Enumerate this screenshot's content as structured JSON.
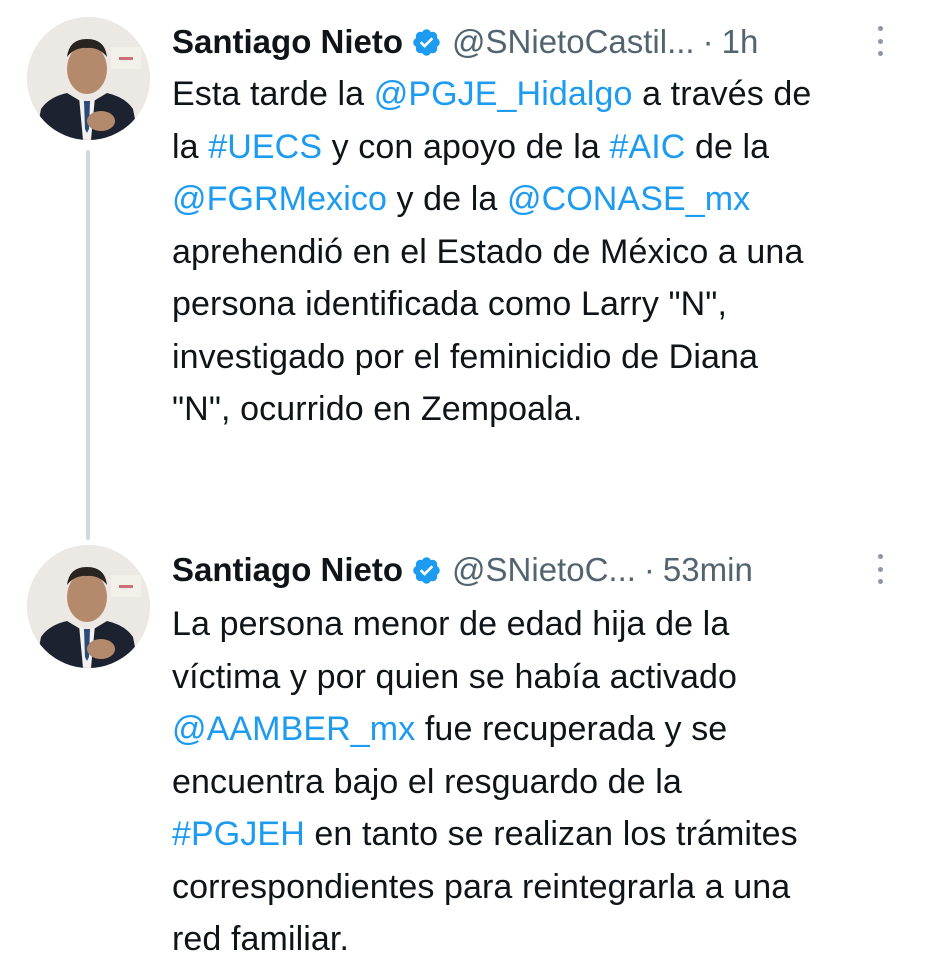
{
  "tweets": [
    {
      "author": {
        "display_name": "Santiago Nieto",
        "handle": "@SNietoCastil...",
        "verified": true,
        "avatar": "profile-photo"
      },
      "separator": "·",
      "time": "1h",
      "more_icon": "more-vertical-icon",
      "text_lines": [
        [
          {
            "t": "Esta tarde la "
          },
          {
            "t": "@PGJE_Hidalgo",
            "link": true
          },
          {
            "t": " a través de"
          }
        ],
        [
          {
            "t": "la "
          },
          {
            "t": "#UECS",
            "link": true
          },
          {
            "t": " y con apoyo de la "
          },
          {
            "t": "#AIC",
            "link": true
          },
          {
            "t": " de la"
          }
        ],
        [
          {
            "t": "@FGRMexico",
            "link": true
          },
          {
            "t": " y de la "
          },
          {
            "t": "@CONASE_mx",
            "link": true
          }
        ],
        [
          {
            "t": "aprehendió en el Estado de México a una"
          }
        ],
        [
          {
            "t": "persona identificada como Larry \"N\","
          }
        ],
        [
          {
            "t": "investigado por el feminicidio de Diana"
          }
        ],
        [
          {
            "t": "\"N\", ocurrido en Zempoala."
          }
        ]
      ]
    },
    {
      "author": {
        "display_name": "Santiago Nieto",
        "handle": "@SNietoC...",
        "verified": true,
        "avatar": "profile-photo"
      },
      "separator": "·",
      "time": "53min",
      "more_icon": "more-vertical-icon",
      "text_lines": [
        [
          {
            "t": "La persona menor de edad hija de la"
          }
        ],
        [
          {
            "t": "víctima y por quien se había activado"
          }
        ],
        [
          {
            "t": "@AAMBER_mx",
            "link": true
          },
          {
            "t": " fue recuperada y se"
          }
        ],
        [
          {
            "t": "encuentra bajo el resguardo de la"
          }
        ],
        [
          {
            "t": "#PGJEH",
            "link": true
          },
          {
            "t": " en tanto se realizan los trámites"
          }
        ],
        [
          {
            "t": "correspondientes para reintegrarla a una"
          }
        ],
        [
          {
            "t": "red familiar."
          }
        ]
      ]
    }
  ],
  "colors": {
    "link": "#1d9bf0",
    "text": "#0f1419",
    "secondary": "#536471",
    "verified": "#1d9bf0",
    "thread_line": "#cfd9de"
  }
}
